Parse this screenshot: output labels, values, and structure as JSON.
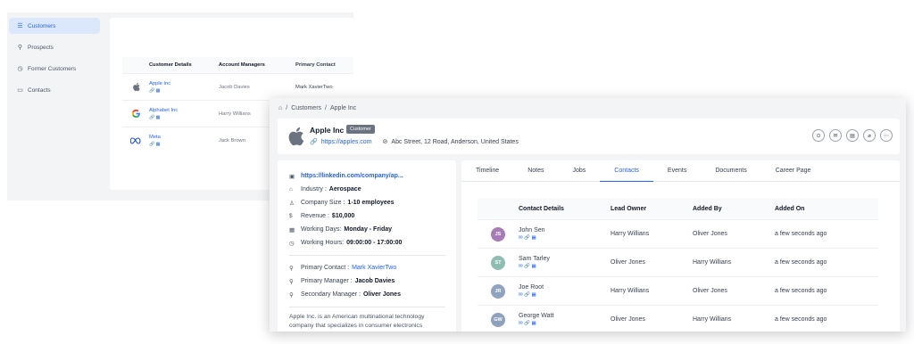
{
  "sidebar": {
    "items": [
      {
        "icon": "customers-icon",
        "glyph": "☰",
        "label": "Customers",
        "active": true
      },
      {
        "icon": "person-icon",
        "glyph": "⚲",
        "label": "Prospects"
      },
      {
        "icon": "history-icon",
        "glyph": "◷",
        "label": "Former Customers"
      },
      {
        "icon": "id-card-icon",
        "glyph": "▭",
        "label": "Contacts"
      }
    ]
  },
  "customers_table": {
    "headers": [
      "Customer Details",
      "Account Managers",
      "Primary Contact"
    ],
    "rows": [
      {
        "name": "Apple Inc",
        "manager": "Jacob Davies",
        "contact": "Mark XavierTwo",
        "logo": "apple-logo"
      },
      {
        "name": "Alphabet Inc",
        "manager": "Harry Willians",
        "contact": "",
        "logo": "google-logo"
      },
      {
        "name": "Meta",
        "manager": "Jack Brown",
        "contact": "",
        "logo": "meta-logo"
      }
    ],
    "row_icons": "🔗 ▦"
  },
  "breadcrumb": {
    "home_glyph": "⌂",
    "sep": "/",
    "items": [
      "Customers",
      "Apple Inc"
    ]
  },
  "company": {
    "name": "Apple Inc",
    "tag": "Customer",
    "website": "https://apples.com",
    "address": "Abc Street, 12 Road, Anderson, United States",
    "action_icons": [
      "⊙",
      "✉",
      "▤",
      "⌀",
      "⋯"
    ]
  },
  "details": {
    "linkedin": "https://linkedin.com/company/ap...",
    "industry_label": "Industry :",
    "industry": "Aerospace",
    "size_label": "Company Size :",
    "size": "1-10 employees",
    "revenue_label": "Revenue :",
    "revenue": "$10,000",
    "days_label": "Working Days:",
    "days": "Monday - Friday",
    "hours_label": "Working Hours:",
    "hours": "09:00:00 - 17:00:00",
    "primary_contact_label": "Primary Contact :",
    "primary_contact": "Mark XavierTwo",
    "primary_manager_label": "Primary Manager :",
    "primary_manager": "Jacob Davies",
    "secondary_manager_label": "Secondary Manager :",
    "secondary_manager": "Oliver Jones",
    "description": "Apple Inc. is an American multinational technology company that specializes in consumer electronics"
  },
  "tabs": [
    "Timeline",
    "Notes",
    "Jobs",
    "Contacts",
    "Events",
    "Documents",
    "Career Page"
  ],
  "active_tab": "Contacts",
  "contacts": {
    "headers": [
      "Contact Details",
      "Lead Owner",
      "Added By",
      "Added On"
    ],
    "rows": [
      {
        "initials": "JS",
        "color": "#a77bb4",
        "name": "John Sen",
        "lead_owner": "Harry Willians",
        "added_by": "Oliver Jones",
        "added_on": "a few seconds ago"
      },
      {
        "initials": "ST",
        "color": "#8fbdb2",
        "name": "Sam Tarley",
        "lead_owner": "Oliver Jones",
        "added_by": "Harry Willians",
        "added_on": "a few seconds ago"
      },
      {
        "initials": "JR",
        "color": "#8ea3c0",
        "name": "Joe Root",
        "lead_owner": "Harry Willians",
        "added_by": "Oliver Jones",
        "added_on": "a few seconds ago"
      },
      {
        "initials": "GW",
        "color": "#8fa2bd",
        "name": "George Watt",
        "lead_owner": "Oliver Jones",
        "added_by": "Harry Willians",
        "added_on": "a few seconds ago"
      }
    ],
    "row_icons": "✉ 🔗 ▦"
  },
  "colors": {
    "accent": "#2563eb",
    "active_bg": "#dbe8fb"
  }
}
